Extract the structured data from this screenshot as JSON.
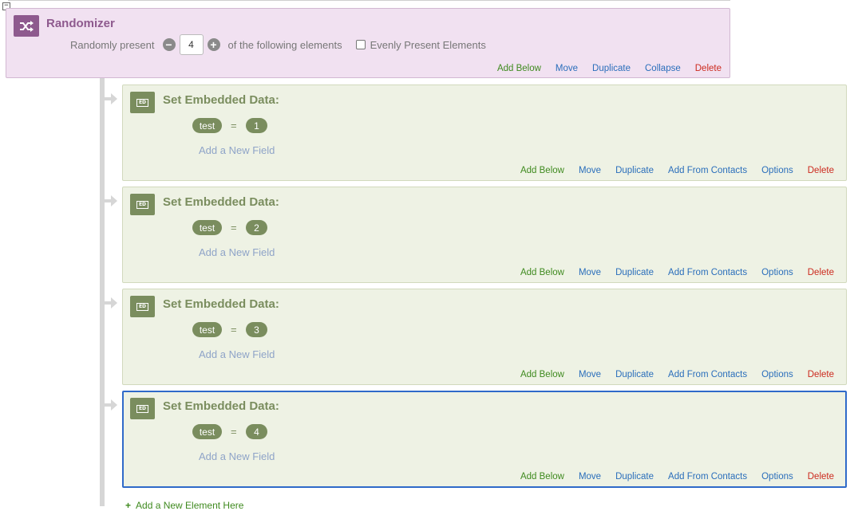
{
  "randomizer": {
    "title": "Randomizer",
    "label_before": "Randomly present",
    "count": "4",
    "label_after": "of the following elements",
    "evenly_label": "Evenly Present Elements",
    "evenly_checked": false,
    "actions": {
      "add_below": "Add Below",
      "move": "Move",
      "duplicate": "Duplicate",
      "collapse": "Collapse",
      "delete": "Delete"
    }
  },
  "embedded_blocks": [
    {
      "icon_text": "ED",
      "title": "Set Embedded Data:",
      "field": "test",
      "equals": "=",
      "value": "1",
      "add_field": "Add a New Field"
    },
    {
      "icon_text": "ED",
      "title": "Set Embedded Data:",
      "field": "test",
      "equals": "=",
      "value": "2",
      "add_field": "Add a New Field"
    },
    {
      "icon_text": "ED",
      "title": "Set Embedded Data:",
      "field": "test",
      "equals": "=",
      "value": "3",
      "add_field": "Add a New Field"
    },
    {
      "icon_text": "ED",
      "title": "Set Embedded Data:",
      "field": "test",
      "equals": "=",
      "value": "4",
      "add_field": "Add a New Field"
    }
  ],
  "block_actions": {
    "add_below": "Add Below",
    "move": "Move",
    "duplicate": "Duplicate",
    "add_from_contacts": "Add From Contacts",
    "options": "Options",
    "delete": "Delete"
  },
  "bottom": {
    "icon": "plus-icon",
    "label": "Add a New Element Here"
  },
  "colors": {
    "randomizer_bg": "#f1e1f1",
    "randomizer_accent": "#8e5a8e",
    "embedded_bg": "#eef2e4",
    "embedded_accent": "#7a8d5e",
    "link_green": "#3f8a1f",
    "link_blue": "#2a6ebb",
    "link_red": "#cc2a1e",
    "selected_border": "#2f6ac9"
  }
}
